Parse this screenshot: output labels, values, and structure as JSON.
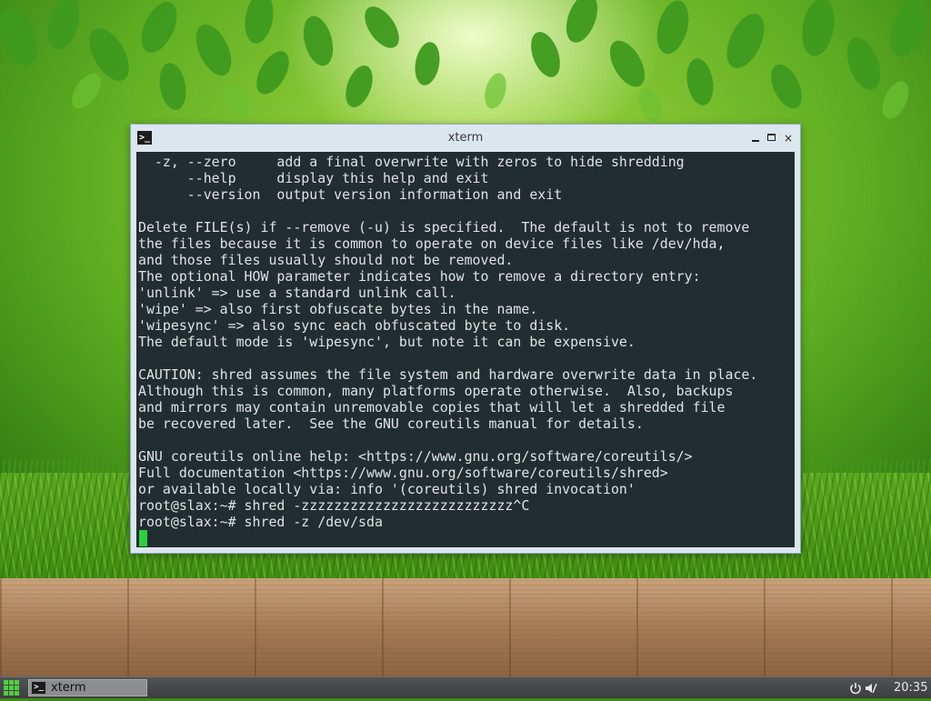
{
  "window": {
    "title": "xterm",
    "icon": "terminal-icon",
    "controls": {
      "minimize": "minimize-icon",
      "maximize": "maximize-icon",
      "close_glyph": "×"
    }
  },
  "terminal": {
    "lines": [
      "  -z, --zero     add a final overwrite with zeros to hide shredding",
      "      --help     display this help and exit",
      "      --version  output version information and exit",
      "",
      "Delete FILE(s) if --remove (-u) is specified.  The default is not to remove",
      "the files because it is common to operate on device files like /dev/hda,",
      "and those files usually should not be removed.",
      "The optional HOW parameter indicates how to remove a directory entry:",
      "'unlink' => use a standard unlink call.",
      "'wipe' => also first obfuscate bytes in the name.",
      "'wipesync' => also sync each obfuscated byte to disk.",
      "The default mode is 'wipesync', but note it can be expensive.",
      "",
      "CAUTION: shred assumes the file system and hardware overwrite data in place.",
      "Although this is common, many platforms operate otherwise.  Also, backups",
      "and mirrors may contain unremovable copies that will let a shredded file",
      "be recovered later.  See the GNU coreutils manual for details.",
      "",
      "GNU coreutils online help: <https://www.gnu.org/software/coreutils/>",
      "Full documentation <https://www.gnu.org/software/coreutils/shred>",
      "or available locally via: info '(coreutils) shred invocation'",
      "root@slax:~# shred -zzzzzzzzzzzzzzzzzzzzzzzzzz^C",
      "root@slax:~# shred -z /dev/sda"
    ],
    "background": "#222d32",
    "foreground": "#dfe3e4",
    "cursor_color": "#2ad13c"
  },
  "taskbar": {
    "start_icon": "app-grid-icon",
    "items": [
      {
        "label": "xterm",
        "icon": "terminal-icon"
      }
    ],
    "tray": {
      "power_icon": "power-icon",
      "volume_icon": "volume-muted-icon",
      "clock": "20:35"
    }
  }
}
